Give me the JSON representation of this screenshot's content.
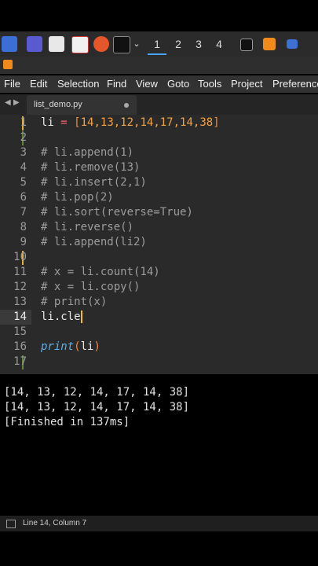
{
  "taskbar": {
    "workspaces": [
      "1",
      "2",
      "3",
      "4"
    ],
    "icons": [
      "app-launcher-icon",
      "monitor-icon",
      "file-manager-icon",
      "pdf-icon",
      "firefox-icon",
      "terminal-icon",
      "chevron-down-icon",
      "terminal-small-icon",
      "sublime-icon",
      "folder-icon"
    ]
  },
  "menu": {
    "items": [
      "File",
      "Edit",
      "Selection",
      "Find",
      "View",
      "Goto",
      "Tools",
      "Project",
      "Preference"
    ]
  },
  "tabs": [
    {
      "label": "list_demo.py",
      "modified": true
    }
  ],
  "editor": {
    "lines": [
      {
        "num": "1",
        "text": "li = [14,13,12,14,17,14,38]"
      },
      {
        "num": "2",
        "text": ""
      },
      {
        "num": "3",
        "text": "# li.append(1)"
      },
      {
        "num": "4",
        "text": "# li.remove(13)"
      },
      {
        "num": "5",
        "text": "# li.insert(2,1)"
      },
      {
        "num": "6",
        "text": "# li.pop(2)"
      },
      {
        "num": "7",
        "text": "# li.sort(reverse=True)"
      },
      {
        "num": "8",
        "text": "# li.reverse()"
      },
      {
        "num": "9",
        "text": "# li.append(li2)"
      },
      {
        "num": "10",
        "text": ""
      },
      {
        "num": "11",
        "text": "# x = li.count(14)"
      },
      {
        "num": "12",
        "text": "# x = li.copy()"
      },
      {
        "num": "13",
        "text": "# print(x)"
      },
      {
        "num": "14",
        "text": "li.cle"
      },
      {
        "num": "15",
        "text": ""
      },
      {
        "num": "16",
        "text": "print(li)"
      },
      {
        "num": "17",
        "text": ""
      }
    ],
    "line1": {
      "var": "li",
      "eq": "=",
      "open": "[",
      "values": "14,13,12,14,17,14,38",
      "close": "]"
    },
    "line16": {
      "fn": "print",
      "open": "(",
      "arg": "li",
      "close": ")"
    }
  },
  "output": {
    "lines": [
      "[14, 13, 12, 14, 17, 14, 38]",
      "[14, 13, 12, 14, 17, 14, 38]",
      "[Finished in 137ms]"
    ]
  },
  "status": {
    "position": "Line 14, Column 7"
  },
  "colors": {
    "accent": "#4aa3ff",
    "number": "#f2a343",
    "function": "#5ab0e8",
    "comment": "#9c9c9c"
  }
}
